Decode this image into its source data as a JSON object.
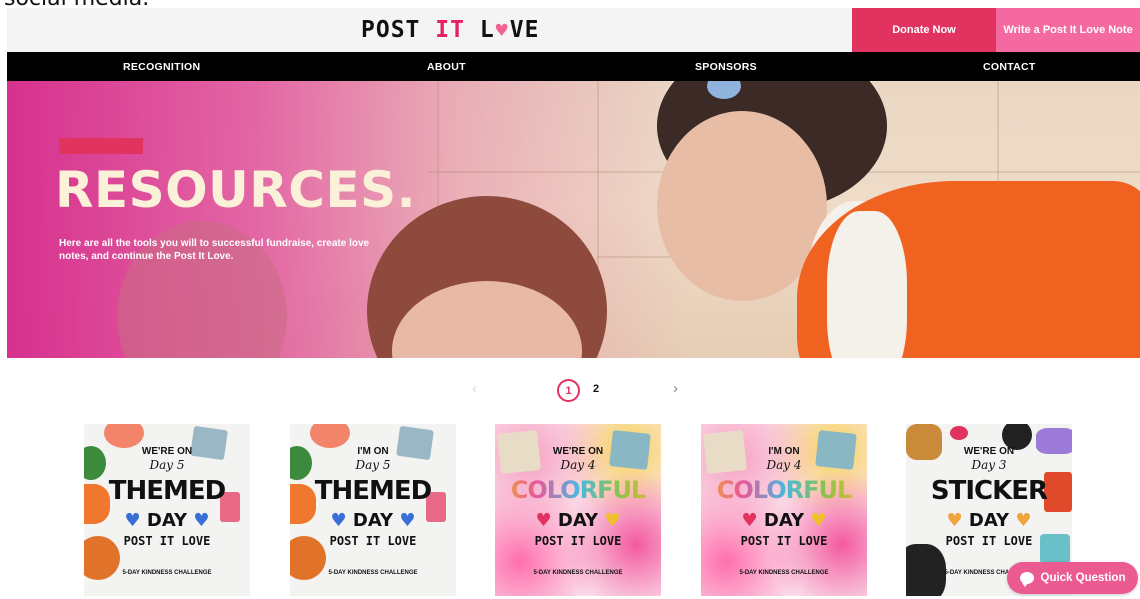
{
  "top_caption": "social media.",
  "header": {
    "logo_left": "POST",
    "logo_i": "IT",
    "logo_l": "L",
    "logo_heart": "♥",
    "logo_right": "VE",
    "donate_label": "Donate Now",
    "write_label": "Write a Post It Love Note"
  },
  "nav": {
    "items": [
      "RECOGNITION",
      "ABOUT",
      "SPONSORS",
      "CONTACT"
    ]
  },
  "hero": {
    "title": "RESOURCES.",
    "subtitle": "Here are all the tools you will to successful fundraise, create love notes, and continue the Post It Love."
  },
  "pagination": {
    "prev": "‹",
    "page1": "1",
    "page2": "2",
    "next": "›"
  },
  "cards": [
    {
      "line1": "WE'RE ON",
      "line2": "Day 5",
      "big": "THEMED",
      "day": "DAY",
      "brand": "POST IT LOVE",
      "challenge": "5-DAY KINDNESS CHALLENGE",
      "big_color": "#111111",
      "heart_color": "#3b6fd8"
    },
    {
      "line1": "I'M ON",
      "line2": "Day 5",
      "big": "THEMED",
      "day": "DAY",
      "brand": "POST IT LOVE",
      "challenge": "5-DAY KINDNESS CHALLENGE",
      "big_color": "#111111",
      "heart_color": "#3b6fd8"
    },
    {
      "line1": "WE'RE ON",
      "line2": "Day 4",
      "big": "COLORFUL",
      "day": "DAY",
      "brand": "POST IT LOVE",
      "challenge": "5-DAY KINDNESS CHALLENGE",
      "big_color": "#e8c12a",
      "heart_color": "#e0335f"
    },
    {
      "line1": "I'M ON",
      "line2": "Day 4",
      "big": "COLORFUL",
      "day": "DAY",
      "brand": "POST IT LOVE",
      "challenge": "5-DAY KINDNESS CHALLENGE",
      "big_color": "#e8c12a",
      "heart_color": "#e0335f"
    },
    {
      "line1": "WE'RE ON",
      "line2": "Day 3",
      "big": "STICKER",
      "day": "DAY",
      "brand": "POST IT LOVE",
      "challenge": "5-DAY KINDNESS CHALLENGE",
      "big_color": "#111111",
      "heart_color": "#f0a43a"
    }
  ],
  "chat": {
    "label": "Quick Question"
  },
  "colors": {
    "accent": "#e0335f",
    "accent_light": "#f46aa0",
    "nav_bg": "#000000",
    "hero_pink": "#d62a8c",
    "hero_title": "#fbf1d9"
  }
}
